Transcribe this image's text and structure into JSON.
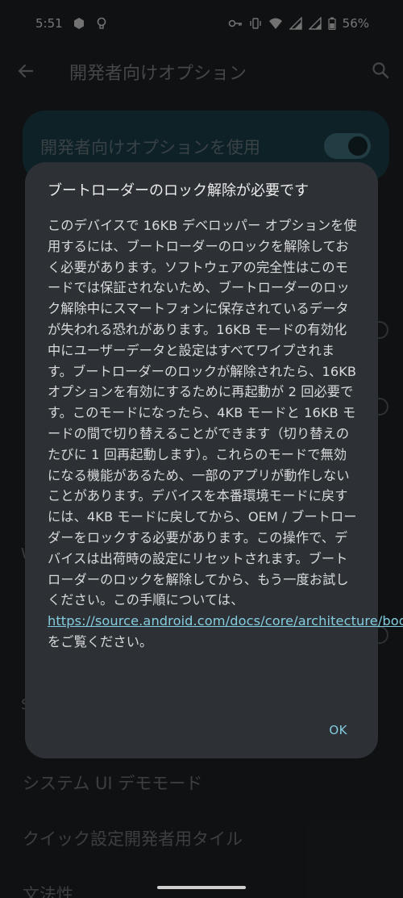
{
  "status_bar": {
    "time": "5:51",
    "battery": "56%"
  },
  "app_bar": {
    "title": "開発者向けオプション"
  },
  "main_toggle": {
    "label": "開発者向けオプションを使用",
    "state": "on"
  },
  "background_items": {
    "demo_mode": "システム UI デモモード",
    "quick_settings_tiles": "クイック設定開発者用タイル",
    "grammar": "文法性",
    "partial_a": "W",
    "partial_b": "S"
  },
  "dialog": {
    "title": "ブートローダーのロック解除が必要です",
    "body_before_link": "このデバイスで 16KB デベロッパー オプションを使用するには、ブートローダーのロックを解除しておく必要があります。ソフトウェアの完全性はこのモードでは保証されないため、ブートローダーのロック解除中にスマートフォンに保存されているデータが失われる恐れがあります。16KB モードの有効化中にユーザーデータと設定はすべてワイプされます。ブートローダーのロックが解除されたら、16KB オプションを有効にするために再起動が 2 回必要です。このモードになったら、4KB モードと 16KB モードの間で切り替えることができます（切り替えのたびに 1 回再起動します）。これらのモードで無効になる機能があるため、一部のアプリが動作しないことがあります。デバイスを本番環境モードに戻すには、4KB モードに戻してから、OEM / ブートローダーをロックする必要があります。この操作で、デバイスは出荷時の設定にリセットされます。ブートローダーのロックを解除してから、もう一度お試しください。この手順については、",
    "link": "https://source.android.com/docs/core/architecture/bootloader/locking_unlocking",
    "body_after_link": " をご覧ください。",
    "ok_label": "OK"
  },
  "colors": {
    "accent": "#84cde0",
    "dialog_bg": "#2d3135",
    "screen_bg": "#1d2023"
  }
}
